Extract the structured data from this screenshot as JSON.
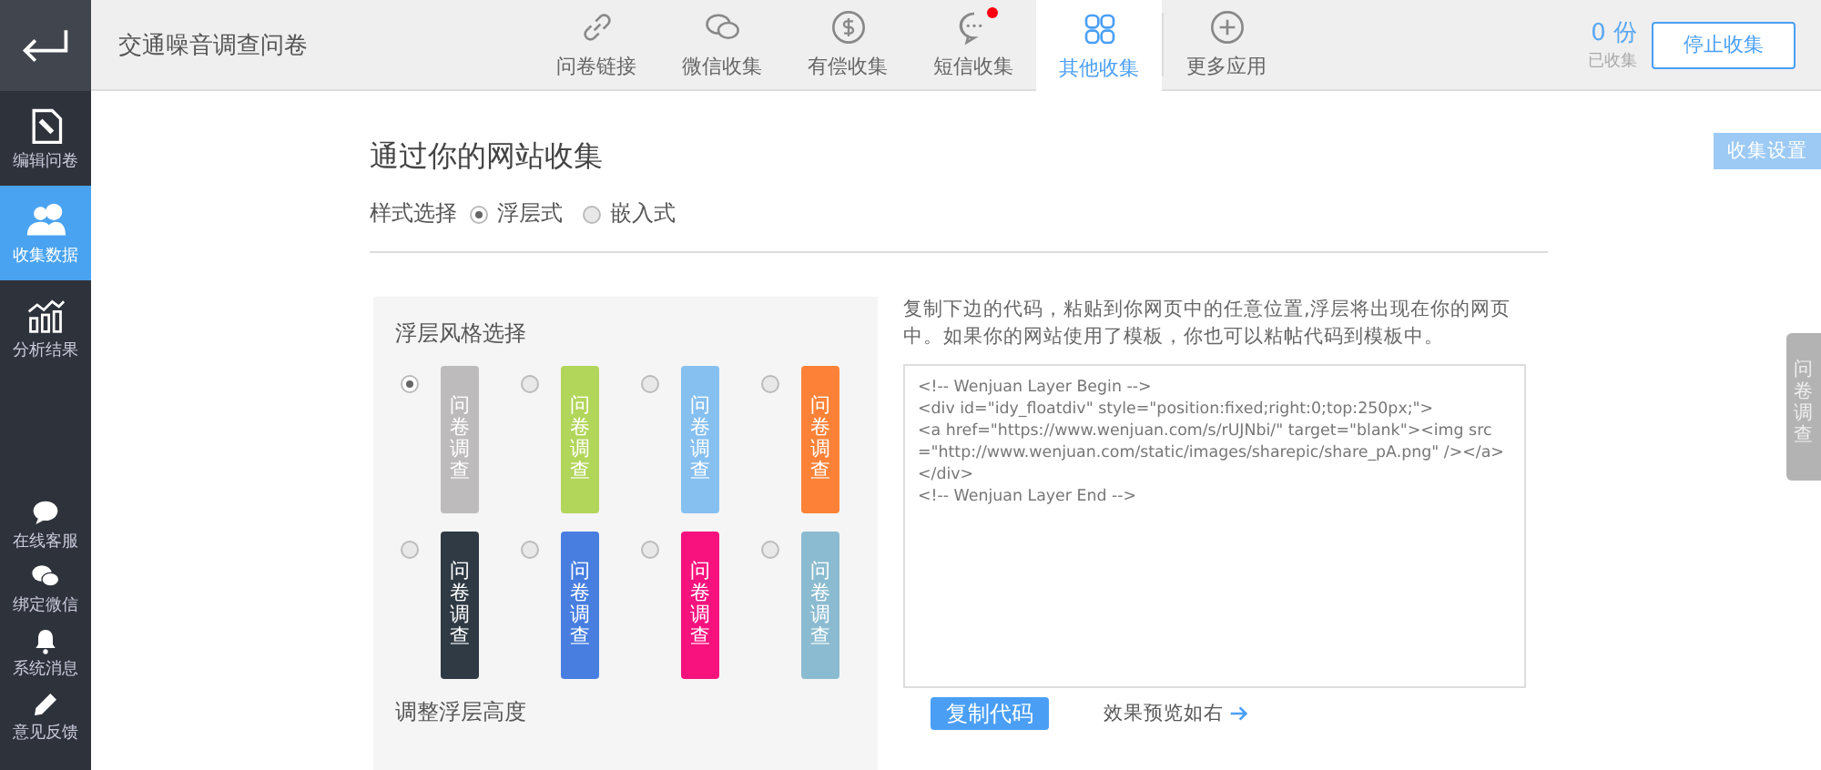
{
  "sidebar": {
    "back": {
      "kind": "back"
    },
    "items": [
      {
        "label": "编辑问卷",
        "selected": false
      },
      {
        "label": "收集数据",
        "selected": true
      },
      {
        "label": "分析结果",
        "selected": false
      }
    ],
    "bottom_items": [
      {
        "label": "在线客服"
      },
      {
        "label": "绑定微信"
      },
      {
        "label": "系统消息"
      },
      {
        "label": "意见反馈"
      }
    ]
  },
  "topbar": {
    "title": "交通噪音调查问卷",
    "tabs": [
      {
        "label": "问卷链接",
        "selected": false,
        "badge": false
      },
      {
        "label": "微信收集",
        "selected": false,
        "badge": false
      },
      {
        "label": "有偿收集",
        "selected": false,
        "badge": false
      },
      {
        "label": "短信收集",
        "selected": false,
        "badge": true
      },
      {
        "label": "其他收集",
        "selected": true,
        "badge": false
      },
      {
        "label": "更多应用",
        "selected": false,
        "badge": false
      }
    ],
    "count": "0 份",
    "count_label": "已收集",
    "stop_button": "停止收集"
  },
  "content": {
    "heading": "通过你的网站收集",
    "style_label": "样式选择",
    "style_options": [
      {
        "label": "浮层式",
        "selected": true
      },
      {
        "label": "嵌入式",
        "selected": false
      }
    ],
    "settings_button": "收集设置",
    "float_tab": "问卷调查",
    "panel": {
      "title": "浮层风格选择",
      "styles": [
        {
          "text": "问卷调查",
          "color": "#bdbbbc",
          "selected": true
        },
        {
          "text": "问卷调查",
          "color": "#b2d65a",
          "selected": false
        },
        {
          "text": "问卷调查",
          "color": "#86c0f0",
          "selected": false
        },
        {
          "text": "问卷调查",
          "color": "#fd8237",
          "selected": false
        },
        {
          "text": "问卷调查",
          "color": "#2f3a44",
          "selected": false
        },
        {
          "text": "问卷调查",
          "color": "#477ee0",
          "selected": false
        },
        {
          "text": "问卷调查",
          "color": "#f8127e",
          "selected": false
        },
        {
          "text": "问卷调查",
          "color": "#8bbbd0",
          "selected": false
        }
      ],
      "height_title": "调整浮层高度"
    },
    "instructions": "复制下边的代码，粘贴到你网页中的任意位置,浮层将出现在你的网页中。如果你的网站使用了模板，你也可以粘帖代码到模板中。",
    "code_lines": [
      "<!-- Wenjuan Layer Begin -->",
      "<div id=\"idy_floatdiv\" style=\"position:fixed;right:0;top:250px;\">",
      "<a href=\"https://www.wenjuan.com/s/rUJNbi/\" target=\"blank\"><img src=\"http://www.wenjuan.com/static/images/sharepic/share_pA.png\" /></a>",
      "</div>",
      "<!-- Wenjuan Layer End -->"
    ],
    "copy_button": "复制代码",
    "preview_link": "效果预览如右"
  }
}
